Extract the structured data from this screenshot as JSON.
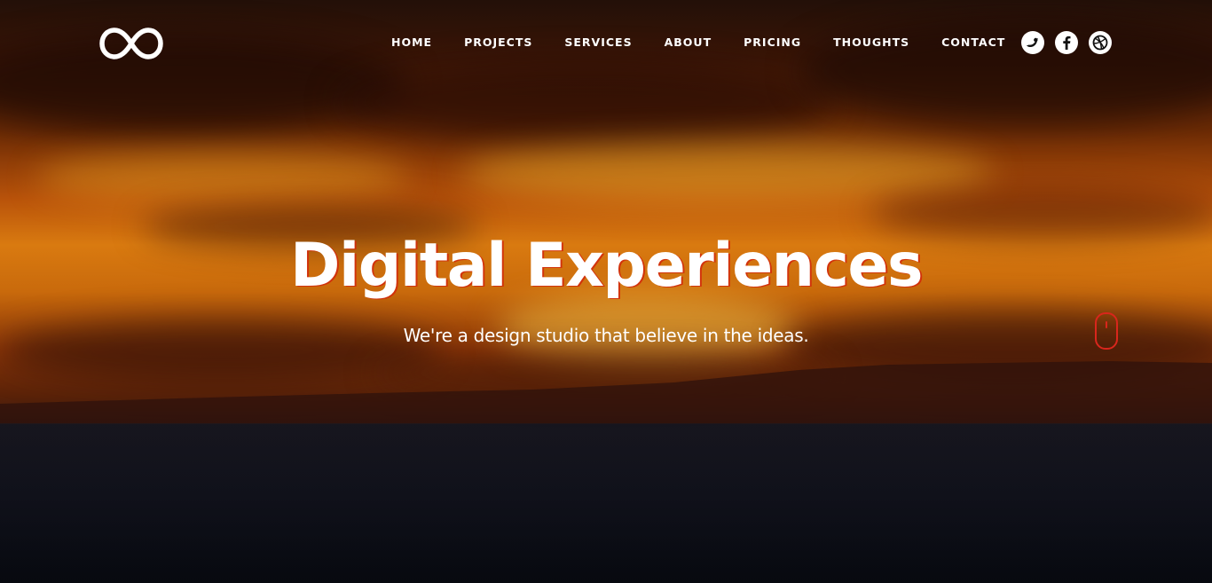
{
  "brand": {
    "logo_icon": "infinity-logo-icon"
  },
  "nav": {
    "items": [
      {
        "label": "HOME"
      },
      {
        "label": "PROJECTS"
      },
      {
        "label": "SERVICES"
      },
      {
        "label": "ABOUT"
      },
      {
        "label": "PRICING"
      },
      {
        "label": "THOUGHTS"
      },
      {
        "label": "CONTACT"
      }
    ]
  },
  "social": [
    {
      "icon": "twitter-bird-icon"
    },
    {
      "icon": "facebook-icon"
    },
    {
      "icon": "dribbble-icon"
    }
  ],
  "hero": {
    "title": "Digital Experiences",
    "subtitle": "We're a design studio that believe in the ideas.",
    "scroll_indicator_icon": "mouse-scroll-icon"
  },
  "colors": {
    "accent": "#d9261c",
    "text": "#ffffff",
    "sea": "#0c0f18"
  }
}
